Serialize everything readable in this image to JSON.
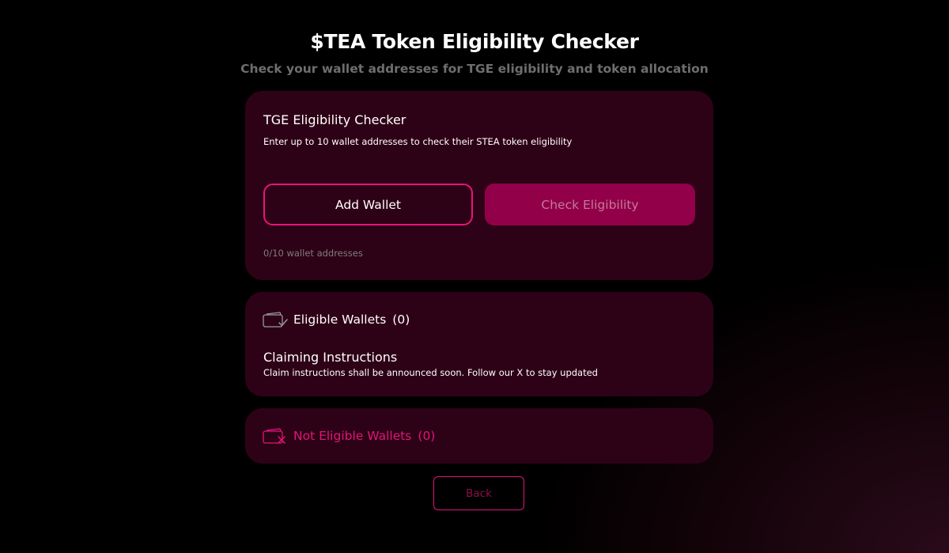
{
  "header": {
    "title": "$TEA Token Eligibility Checker",
    "subtitle": "Check your wallet addresses for TGE eligibility and token allocation"
  },
  "checker": {
    "title": "TGE Eligibility Checker",
    "description": "Enter up to 10 wallet addresses to check their STEA token eligibility",
    "add_wallet_label": "Add Wallet",
    "check_label": "Check Eligibility",
    "count_text": "0/10 wallet addresses"
  },
  "eligible": {
    "icon": "wallet-check-icon",
    "label": "Eligible Wallets",
    "count": "(0)",
    "claim_title": "Claiming Instructions",
    "claim_desc": "Claim instructions shall be announced soon. Follow our X to stay updated"
  },
  "not_eligible": {
    "icon": "wallet-x-icon",
    "label": "Not Eligible Wallets",
    "count": "(0)"
  },
  "back_label": "Back",
  "colors": {
    "accent": "#e0157a",
    "card_bg": "#2e0216",
    "button_fill": "#92004a",
    "page_bg": "#000000"
  }
}
